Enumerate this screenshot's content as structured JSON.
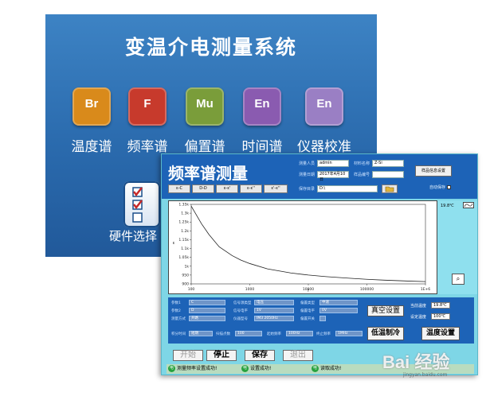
{
  "launcher": {
    "title": "变温介电测量系统",
    "tiles": [
      {
        "icon": "Br",
        "label": "温度谱",
        "color": "#d98a1b"
      },
      {
        "icon": "F",
        "label": "频率谱",
        "color": "#c73a2c"
      },
      {
        "icon": "Mu",
        "label": "偏置谱",
        "color": "#7a9d3a"
      },
      {
        "icon": "En",
        "label": "时间谱",
        "color": "#8a5bb0"
      },
      {
        "icon": "En",
        "label": "仪器校准",
        "color": "#9a7fc4"
      }
    ],
    "hardware_label": "硬件选择"
  },
  "freq_window": {
    "title": "频率谱测量",
    "header": {
      "operator_label": "测量人员",
      "operator_value": "admin",
      "material_label": "材料名称",
      "material_value": "Z-Si",
      "date_label": "测量日期",
      "date_value": "2017年4月10日",
      "sample_label": "样品编号",
      "sample_value": "",
      "save_path_label": "保存目录",
      "save_path_value": "D:\\",
      "sample_info_button": "样品信息设置",
      "autosave_label": "自动保存",
      "param_buttons": [
        "ε-C",
        "D-D",
        "ε-ε'",
        "ε-ε''",
        "ε'-ε''"
      ]
    },
    "temperature_reading": "19.8℃",
    "chart_tool_icon": "zoom-icon",
    "controls": {
      "left_fields": [
        {
          "label": "参数1",
          "value": "C"
        },
        {
          "label": "参数2",
          "value": "D"
        },
        {
          "label": "测量方式",
          "value": "开路"
        },
        {
          "label": "积分时间",
          "value": "短期"
        }
      ],
      "mid_fields": [
        {
          "label": "信号源类型",
          "value": "电压"
        },
        {
          "label": "信号电平",
          "value": "1V"
        },
        {
          "label": "仪器型号",
          "value": "IM3 2050Hz"
        },
        {
          "label": "扫描点数",
          "value": "100"
        }
      ],
      "right_fields": [
        {
          "label": "偏置类型",
          "value": "中速"
        },
        {
          "label": "偏置电平",
          "value": "0V"
        },
        {
          "label": "偏置开关",
          "value": ""
        },
        {
          "label": "起始频率",
          "value": "100Hz"
        },
        {
          "label": "终止频率",
          "value": "1MHz"
        }
      ],
      "vacuum_button": "真空设置",
      "cryo_button": "低温制冷",
      "temp_set_button": "温度设置",
      "current_temp_label": "当前温度",
      "current_temp_value": "19.8℃",
      "set_temp_label": "设定温度",
      "set_temp_value": "100℃"
    },
    "actions": {
      "start": "开始",
      "stop": "停止",
      "save": "保存",
      "exit": "退出"
    },
    "status": [
      {
        "icon": "电",
        "text": "测量频率设置成功!"
      },
      {
        "icon": "电",
        "text": "设置成功!"
      },
      {
        "icon": "电",
        "text": "读取成功!"
      }
    ]
  },
  "watermark": {
    "main": "Bai 经验",
    "sub": "jingyan.baidu.com"
  },
  "chart_data": {
    "type": "line",
    "xlabel": "f",
    "ylabel": "ε",
    "x_scale": "log",
    "xlim": [
      100,
      1000000
    ],
    "ylim": [
      900,
      1350
    ],
    "x_ticks": [
      "100",
      "1000",
      "10000",
      "100000",
      "1E+6"
    ],
    "y_ticks": [
      "1.35k",
      "1.3k",
      "1.25k",
      "1.2k",
      "1.15k",
      "1.1k",
      "1.05k",
      "1k",
      "950",
      "900"
    ],
    "series": [
      {
        "x": [
          100,
          150,
          200,
          300,
          500,
          700,
          1000,
          2000,
          5000,
          10000,
          20000,
          50000,
          100000,
          200000,
          500000,
          1000000
        ],
        "y": [
          1340,
          1240,
          1180,
          1110,
          1060,
          1035,
          1015,
          985,
          962,
          950,
          941,
          932,
          926,
          921,
          916,
          913
        ]
      }
    ]
  }
}
